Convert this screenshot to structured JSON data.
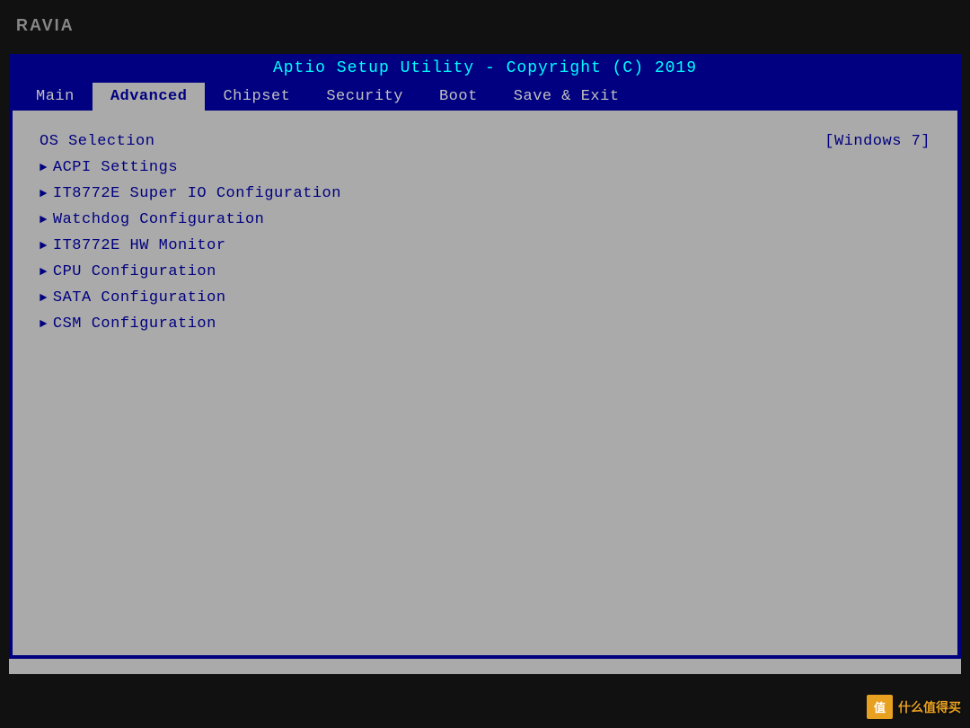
{
  "brand": "RAVIA",
  "header": {
    "title": "Aptio Setup Utility - Copyright (C) 2019"
  },
  "nav": {
    "tabs": [
      {
        "id": "main",
        "label": "Main",
        "active": false
      },
      {
        "id": "advanced",
        "label": "Advanced",
        "active": true
      },
      {
        "id": "chipset",
        "label": "Chipset",
        "active": false
      },
      {
        "id": "security",
        "label": "Security",
        "active": false
      },
      {
        "id": "boot",
        "label": "Boot",
        "active": false
      },
      {
        "id": "save-exit",
        "label": "Save & Exit",
        "active": false
      }
    ]
  },
  "menu": {
    "items": [
      {
        "id": "os-selection",
        "label": "OS Selection",
        "arrow": false,
        "value": "[Windows 7]"
      },
      {
        "id": "acpi-settings",
        "label": "ACPI Settings",
        "arrow": true,
        "value": null
      },
      {
        "id": "it8772e-super-io",
        "label": "IT8772E Super IO Configuration",
        "arrow": true,
        "value": null
      },
      {
        "id": "watchdog",
        "label": "Watchdog Configuration",
        "arrow": true,
        "value": null
      },
      {
        "id": "it8772e-hw",
        "label": "IT8772E HW Monitor",
        "arrow": true,
        "value": null
      },
      {
        "id": "cpu-config",
        "label": "CPU Configuration",
        "arrow": true,
        "value": null
      },
      {
        "id": "sata-config",
        "label": "SATA Configuration",
        "arrow": true,
        "value": null
      },
      {
        "id": "csm-config",
        "label": "CSM Configuration",
        "arrow": true,
        "value": null
      }
    ]
  },
  "watermark": {
    "box_text": "值",
    "site_text": "什么值得买"
  }
}
